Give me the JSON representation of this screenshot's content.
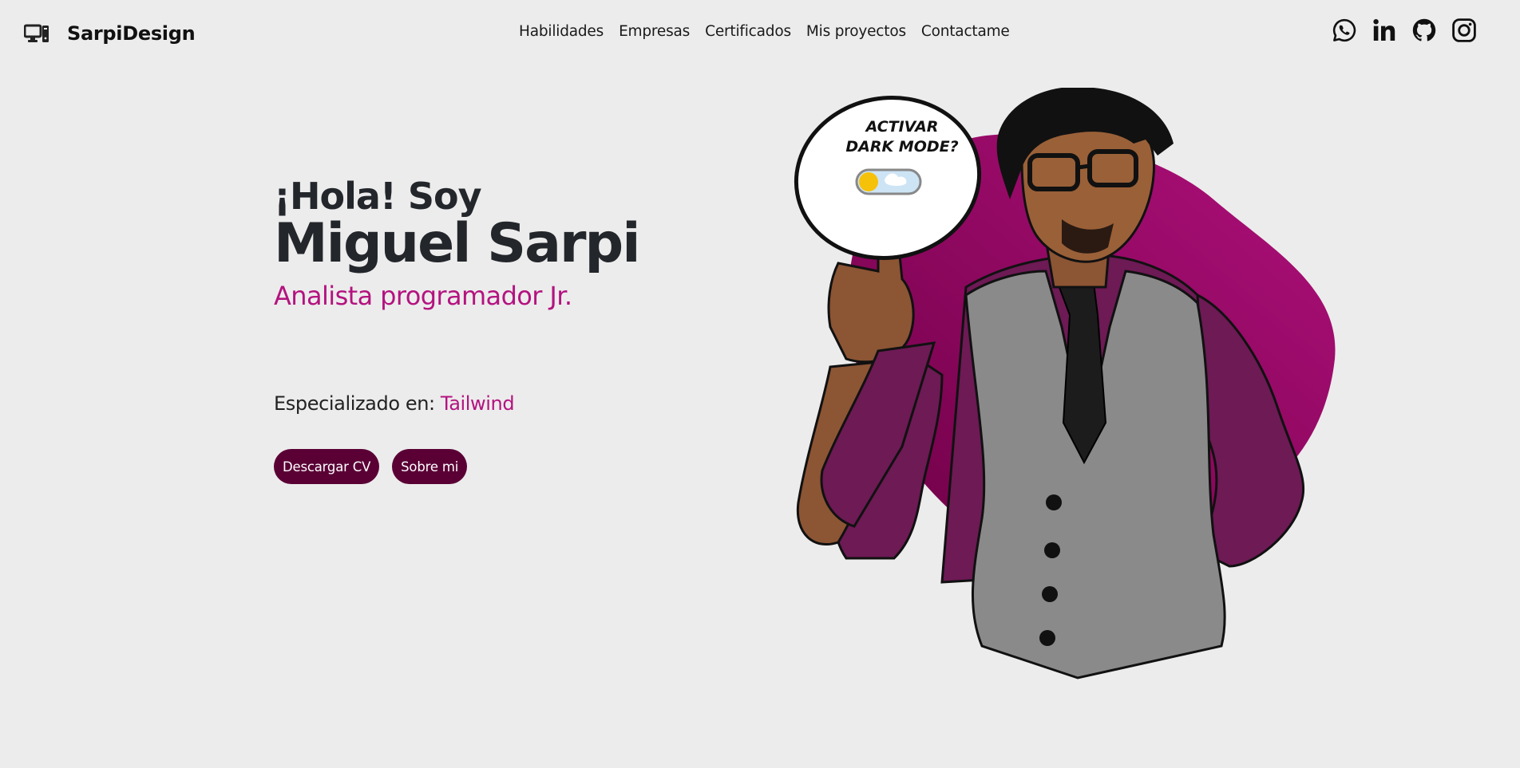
{
  "header": {
    "brand_name": "SarpiDesign",
    "brand_icon": "desktop-computer-icon",
    "nav": [
      {
        "label": "Habilidades"
      },
      {
        "label": "Empresas"
      },
      {
        "label": "Certificados"
      },
      {
        "label": "Mis proyectos"
      },
      {
        "label": "Contactame"
      }
    ],
    "social": [
      {
        "icon": "whatsapp-icon"
      },
      {
        "icon": "linkedin-icon"
      },
      {
        "icon": "github-icon"
      },
      {
        "icon": "instagram-icon"
      }
    ]
  },
  "hero": {
    "greeting": "¡Hola! Soy",
    "name": "Miguel Sarpi",
    "role": "Analista programador Jr.",
    "specialized_label": "Especializado en: ",
    "specialized_tech": "Tailwind",
    "buttons": {
      "cv": "Descargar CV",
      "about": "Sobre mi"
    }
  },
  "illustration": {
    "bubble_line1": "ACTIVAR",
    "bubble_line2": "DARK MODE?",
    "toggle_state": "off"
  },
  "colors": {
    "background": "#ececec",
    "accent": "#b3137f",
    "button": "#5a0035",
    "blob": "#a0066f"
  }
}
